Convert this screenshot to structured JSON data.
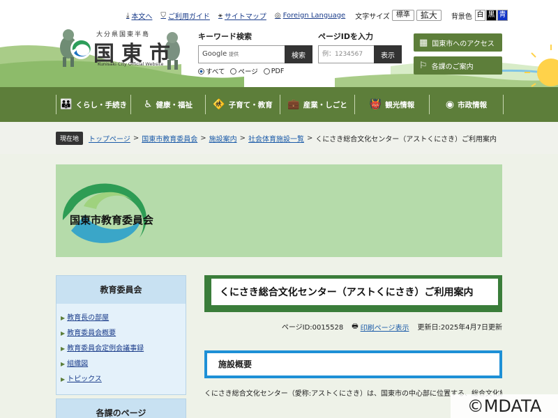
{
  "util_bar": {
    "text_only": "本文へ",
    "guide": "ご利用ガイド",
    "sitemap": "サイトマップ",
    "foreign": "Foreign Language",
    "font_size_label": "文字サイズ",
    "font_standard": "標準",
    "font_large": "拡大",
    "bg_label": "背景色",
    "bg_white": "白",
    "bg_black": "黒",
    "bg_blue": "青"
  },
  "logo": {
    "prefix": "大分県国東半島",
    "name": "国東市",
    "english": "Kunisaki City Official Website"
  },
  "search": {
    "title": "キーワード検索",
    "placeholder": "Google 提供",
    "button": "検索",
    "options": [
      "すべて",
      "ページ",
      "PDF"
    ]
  },
  "pageid_search": {
    "title": "ページIDを入力",
    "placeholder": "例：1234567",
    "button": "表示"
  },
  "quick_links": {
    "access": "国東市へのアクセス",
    "departments": "各課のご案内"
  },
  "gnav": [
    {
      "label": "くらし・手続き",
      "icon": "family-icon"
    },
    {
      "label": "健康・福祉",
      "icon": "wheelchair-icon"
    },
    {
      "label": "子育て・教育",
      "icon": "child-icon"
    },
    {
      "label": "産業・しごと",
      "icon": "briefcase-icon"
    },
    {
      "label": "観光情報",
      "icon": "mascot-icon"
    },
    {
      "label": "市政情報",
      "icon": "city-mark-icon"
    }
  ],
  "breadcrumb": {
    "here": "現在地",
    "items": [
      "トップページ",
      "国東市教育委員会",
      "施設案内",
      "社会体育施設一覧"
    ],
    "current": "くにさき総合文化センター（アストくにさき）ご利用案内"
  },
  "banner": {
    "title": "国東市教育委員会"
  },
  "sidebar": {
    "box1_title": "教育委員会",
    "box1_items": [
      "教育長の部屋",
      "教育委員会概要",
      "教育委員会定例会議事録",
      "組織図",
      "トピックス"
    ],
    "box2_title": "各課のページ"
  },
  "content": {
    "page_title": "くにさき総合文化センター（アストくにさき）ご利用案内",
    "page_id": "ページID:0015528",
    "print": "印刷ページ表示",
    "updated": "更新日:2025年4月7日更新",
    "section_title": "施設概要",
    "body": "くにさき総合文化センター（愛称:アストくにさき）は、国東市の中心部に位置する、総合文化施設です。"
  },
  "watermark": "©MDATA",
  "colors": {
    "nav_green": "#5d7e3a",
    "banner_green": "#b5dbaa",
    "title_green": "#3a7d3a",
    "section_blue": "#1e90d6",
    "side_blue": "#c8e1f2"
  }
}
